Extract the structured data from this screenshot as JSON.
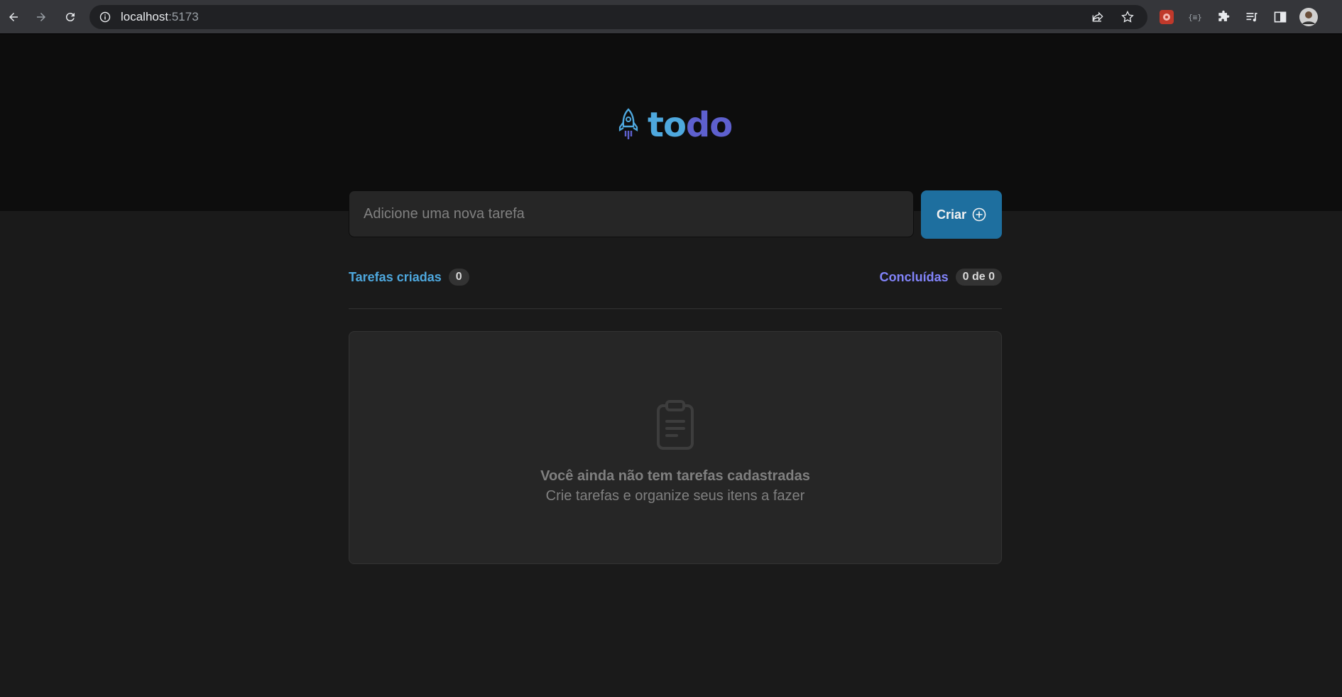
{
  "browser": {
    "url_host": "localhost",
    "url_port": ":5173"
  },
  "app": {
    "logo_part1": "to",
    "logo_part2": "do",
    "input_placeholder": "Adicione uma nova tarefa",
    "create_label": "Criar",
    "stats": {
      "created_label": "Tarefas criadas",
      "created_count": "0",
      "done_label": "Concluídas",
      "done_count": "0 de 0"
    },
    "empty": {
      "title": "Você ainda não tem tarefas cadastradas",
      "subtitle": "Crie tarefas e organize seus itens a fazer"
    }
  },
  "colors": {
    "header_bg": "#0d0d0d",
    "page_bg": "#1a1a1a",
    "blue": "#4ea8de",
    "purple": "#5e60ce",
    "purple_light": "#8284fa",
    "button": "#1e6f9f"
  },
  "icons": {
    "logo": "rocket-icon",
    "create": "plus-circle-icon",
    "empty": "clipboard-icon"
  }
}
